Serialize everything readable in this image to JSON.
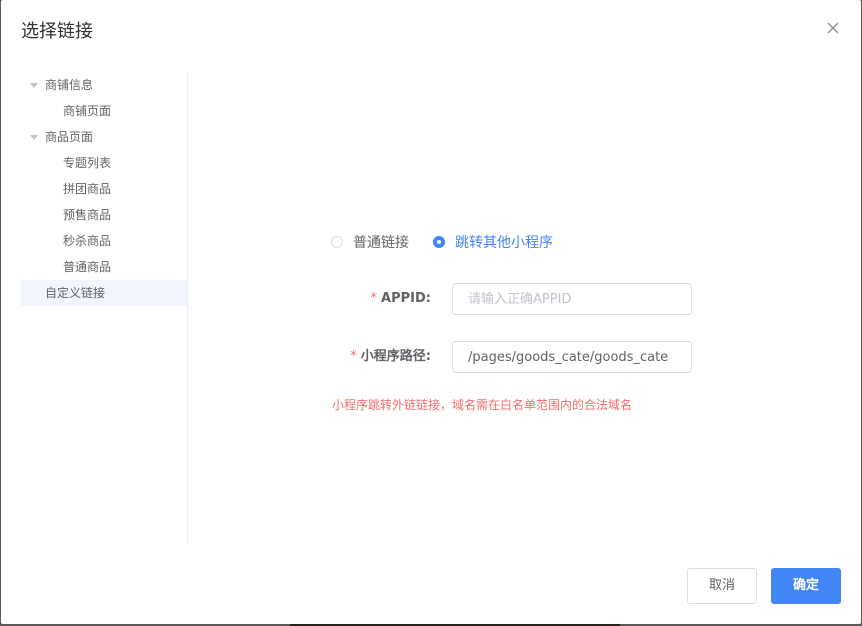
{
  "dialog": {
    "title": "选择链接"
  },
  "tree": {
    "items": [
      {
        "label": "商铺信息",
        "kind": "parent"
      },
      {
        "label": "商铺页面",
        "kind": "child"
      },
      {
        "label": "商品页面",
        "kind": "parent"
      },
      {
        "label": "专题列表",
        "kind": "child"
      },
      {
        "label": "拼团商品",
        "kind": "child"
      },
      {
        "label": "预售商品",
        "kind": "child"
      },
      {
        "label": "秒杀商品",
        "kind": "child"
      },
      {
        "label": "普通商品",
        "kind": "child"
      },
      {
        "label": "自定义链接",
        "kind": "leaf",
        "selected": true
      }
    ]
  },
  "link_type": {
    "options": [
      {
        "label": "普通链接",
        "checked": false
      },
      {
        "label": "跳转其他小程序",
        "checked": true
      }
    ]
  },
  "form": {
    "required_mark": "*",
    "appid": {
      "label": "APPID:",
      "value": "",
      "placeholder": "请输入正确APPID"
    },
    "path": {
      "label": "小程序路径:",
      "value": "/pages/goods_cate/goods_cate",
      "placeholder": ""
    },
    "hint": "小程序跳转外链链接，域名需在白名单范围内的合法域名"
  },
  "footer": {
    "cancel_label": "取消",
    "confirm_label": "确定"
  },
  "colors": {
    "primary": "#4285f4",
    "danger": "#f56c6c",
    "selected_bg": "#f0f5fe"
  },
  "icons": {
    "close": "close-icon",
    "tree_expand": "caret-down-icon"
  }
}
